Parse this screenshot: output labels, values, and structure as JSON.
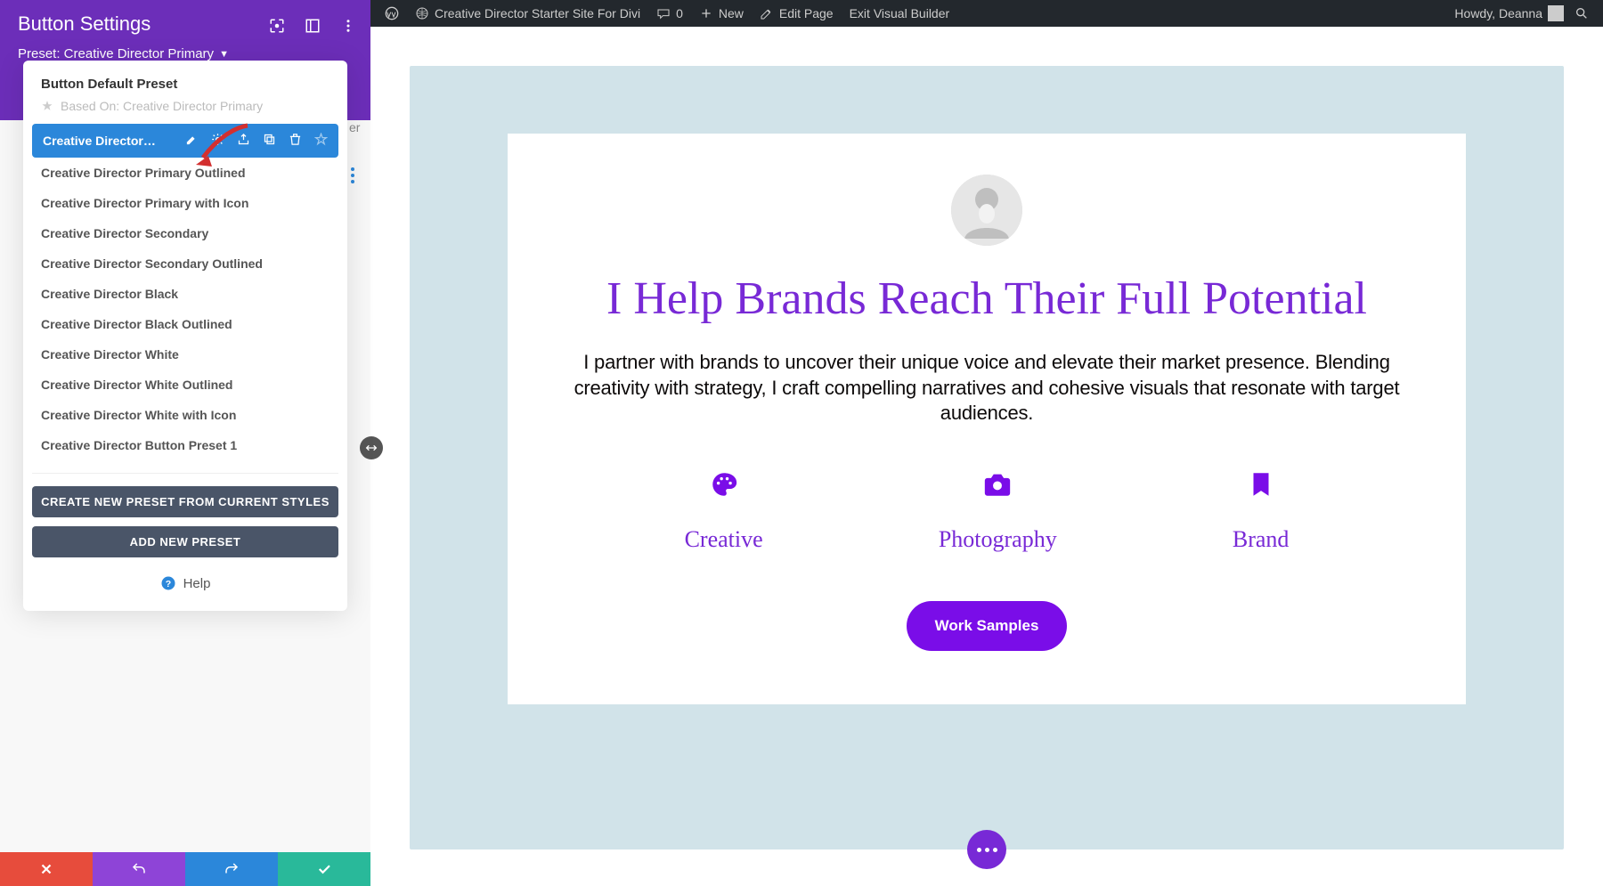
{
  "wp_bar": {
    "site_title": "Creative Director Starter Site For Divi",
    "comments": "0",
    "new": "New",
    "edit_page": "Edit Page",
    "exit_vb": "Exit Visual Builder",
    "howdy": "Howdy, Deanna"
  },
  "panel": {
    "title": "Button Settings",
    "preset_label": "Preset: Creative Director Primary",
    "hidden_tab_text": "er"
  },
  "dropdown": {
    "default_preset": "Button Default Preset",
    "based_on": "Based On: Creative Director Primary",
    "active_item": "Creative Director P...",
    "items": [
      "Creative Director Primary Outlined",
      "Creative Director Primary with Icon",
      "Creative Director Secondary",
      "Creative Director Secondary Outlined",
      "Creative Director Black",
      "Creative Director Black Outlined",
      "Creative Director White",
      "Creative Director White Outlined",
      "Creative Director White with Icon",
      "Creative Director Button Preset 1"
    ],
    "btn_create": "CREATE NEW PRESET FROM CURRENT STYLES",
    "btn_add": "ADD NEW PRESET",
    "help": "Help"
  },
  "page": {
    "hero_title": "I Help Brands Reach Their Full Potential",
    "hero_text": "I partner with brands to uncover their unique voice and elevate their market presence. Blending creativity with strategy, I craft compelling narratives and cohesive visuals that resonate with target audiences.",
    "col1": "Creative",
    "col2": "Photography",
    "col3": "Brand",
    "cta": "Work Samples"
  }
}
